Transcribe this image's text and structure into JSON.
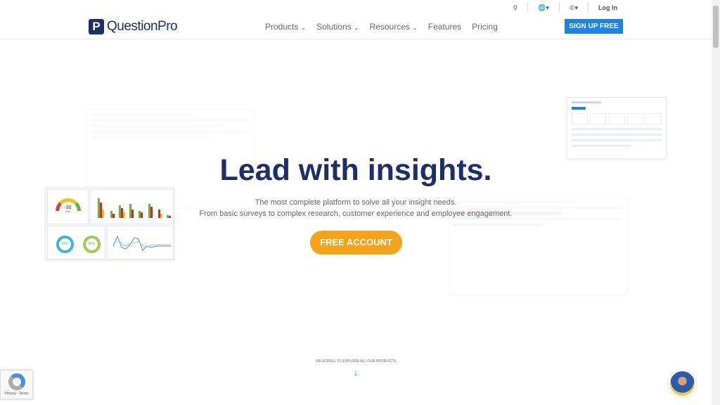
{
  "header": {
    "logo_mark": "P",
    "logo_text": "QuestionPro",
    "utility": {
      "search_icon": "search-icon",
      "globe_icon": "globe-icon",
      "phone_icon": "phone-icon",
      "login": "Log In"
    },
    "nav": [
      {
        "label": "Products",
        "dropdown": true
      },
      {
        "label": "Solutions",
        "dropdown": true
      },
      {
        "label": "Resources",
        "dropdown": true
      },
      {
        "label": "Features",
        "dropdown": false
      },
      {
        "label": "Pricing",
        "dropdown": false
      }
    ],
    "signup": "SIGN UP FREE"
  },
  "hero": {
    "title": "Lead with insights.",
    "subtitle_1": "The most complete platform to solve all your insight needs.",
    "subtitle_2": "From basic surveys to complex research, customer experience and employee engagement.",
    "cta": "FREE ACCOUNT"
  },
  "dashboard": {
    "gauge_value": "-30",
    "gauge_unit": "NPS",
    "ring_1": "99%",
    "ring_2": "60%"
  },
  "scroll_hint": "OR SCROLL TO EXPLORE ALL OUR PRODUCTS",
  "recaptcha": "Privacy - Terms",
  "colors": {
    "brand": "#1c2f6b",
    "accent": "#1b82e6",
    "cta": "#f7a21b"
  }
}
